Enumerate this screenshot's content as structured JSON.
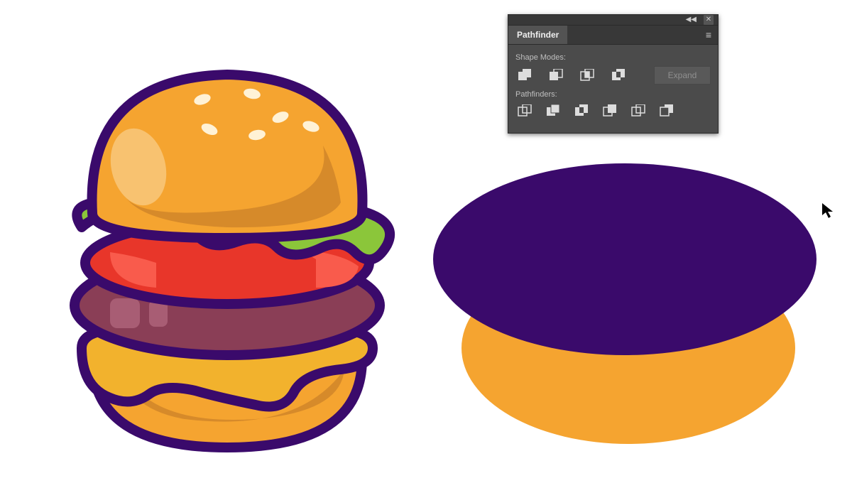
{
  "panel": {
    "tab_label": "Pathfinder",
    "shape_modes_label": "Shape Modes:",
    "pathfinders_label": "Pathfinders:",
    "expand_label": "Expand"
  },
  "artwork": {
    "colors": {
      "outline": "#3a0a6b",
      "bun": "#f5a430",
      "bun_light": "#f8c270",
      "bun_shadow": "#d68a2a",
      "seed": "#fff2d6",
      "lettuce": "#8bc63a",
      "tomato": "#e8362a",
      "tomato_light": "#f95b4c",
      "patty": "#8a3e56",
      "patty_light": "#a85d74",
      "cheese": "#f2b22d",
      "cheese_light": "#f8c85a",
      "purple_shape": "#3a0a6b",
      "orange_shape": "#f5a430"
    }
  }
}
